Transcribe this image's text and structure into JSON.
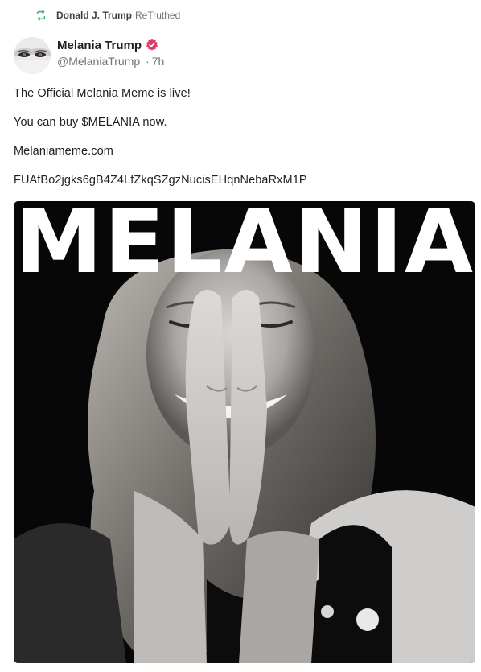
{
  "retruth": {
    "user": "Donald J. Trump",
    "label": "ReTruthed",
    "icon": "retruth-icon"
  },
  "author": {
    "name": "Melania Trump",
    "handle": "@MelaniaTrump",
    "separator": "·",
    "time": "7h",
    "verified_icon": "verified-badge-icon"
  },
  "post": {
    "lines": [
      "The Official Melania Meme is live!",
      "You can buy $MELANIA now.",
      "Melaniameme.com",
      "FUAfBo2jgks6gB4Z4LfZkqSZgzNucisEHqnNebaRxM1P"
    ]
  },
  "media": {
    "headline": "MELANIA"
  },
  "colors": {
    "retruth_green": "#2fb86a",
    "verified_pink": "#e23b6b",
    "text_primary": "#1e1f23",
    "text_secondary": "#6e737c"
  }
}
